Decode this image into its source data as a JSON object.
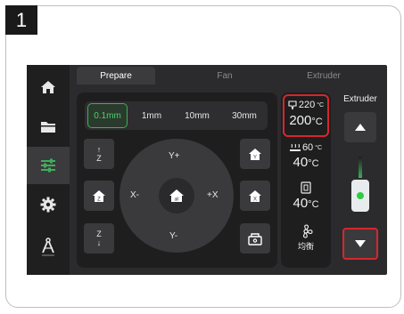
{
  "step_number": "1",
  "tabs": [
    {
      "label": "Prepare",
      "active": true
    },
    {
      "label": "Fan",
      "active": false
    },
    {
      "label": "Extruder",
      "active": false
    }
  ],
  "sidebar": {
    "items": [
      {
        "icon": "home-icon",
        "active": false
      },
      {
        "icon": "folder-icon",
        "active": false
      },
      {
        "icon": "sliders-icon",
        "active": true
      },
      {
        "icon": "gear-icon",
        "active": false
      },
      {
        "icon": "compass-icon",
        "label": "lettiMod",
        "active": false
      }
    ]
  },
  "move": {
    "steps": [
      "0.1mm",
      "1mm",
      "10mm",
      "30mm"
    ],
    "selected_step": "0.1mm",
    "z_up": "Z",
    "z_down": "Z",
    "y_plus": "Y+",
    "y_minus": "Y-",
    "x_minus": "X-",
    "x_plus": "+X",
    "home_all_label": "all",
    "home_x_label": "X",
    "home_y_label": "Y",
    "home_z_label": "Z"
  },
  "temps": {
    "nozzle_target": "220",
    "nozzle_target_unit": "°C",
    "nozzle_current": "200",
    "nozzle_current_unit": "°C",
    "bed_target": "60",
    "bed_target_unit": "°C",
    "bed_current": "40",
    "bed_current_unit": "°C",
    "chamber_current": "40",
    "chamber_current_unit": "°C",
    "balance_label": "均衡"
  },
  "extruder": {
    "label": "Extruder"
  },
  "colors": {
    "accent_green": "#3fae5a",
    "highlight_red": "#d7262d",
    "screen_bg": "#2b2b2d"
  }
}
